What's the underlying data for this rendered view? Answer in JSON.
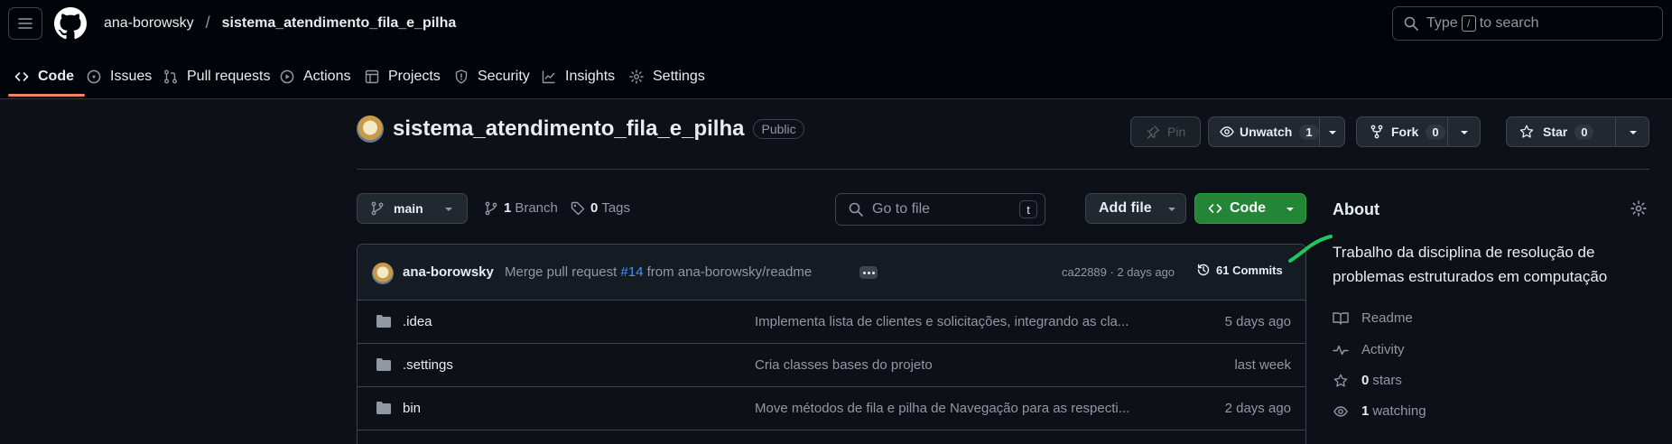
{
  "header": {
    "owner": "ana-borowsky",
    "separator": "/",
    "repo": "sistema_atendimento_fila_e_pilha",
    "search_prefix": "Type",
    "search_key": "/",
    "search_suffix": "to search"
  },
  "tabs": [
    {
      "label": "Code",
      "icon": "code-icon"
    },
    {
      "label": "Issues",
      "icon": "issue-icon"
    },
    {
      "label": "Pull requests",
      "icon": "pull-request-icon"
    },
    {
      "label": "Actions",
      "icon": "play-icon"
    },
    {
      "label": "Projects",
      "icon": "table-icon"
    },
    {
      "label": "Security",
      "icon": "shield-icon"
    },
    {
      "label": "Insights",
      "icon": "graph-icon"
    },
    {
      "label": "Settings",
      "icon": "gear-icon"
    }
  ],
  "repo_header": {
    "name": "sistema_atendimento_fila_e_pilha",
    "visibility": "Public",
    "pin_label": "Pin",
    "unwatch_label": "Unwatch",
    "unwatch_count": "1",
    "fork_label": "Fork",
    "fork_count": "0",
    "star_label": "Star",
    "star_count": "0"
  },
  "controls": {
    "branch": "main",
    "branches_count": "1",
    "branches_label": "Branch",
    "tags_count": "0",
    "tags_label": "Tags",
    "goto_placeholder": "Go to file",
    "goto_key": "t",
    "add_file_label": "Add file",
    "code_label": "Code"
  },
  "latest_commit": {
    "author": "ana-borowsky",
    "message_prefix": "Merge pull request",
    "pr": "#14",
    "message_suffix": "from ana-borowsky/readme",
    "hash_and_time": "ca22889 · 2 days ago",
    "commits_label": "61 Commits"
  },
  "files": [
    {
      "name": ".idea",
      "message": "Implementa lista de clientes e solicitações, integrando as cla...",
      "date": "5 days ago"
    },
    {
      "name": ".settings",
      "message": "Cria classes bases do projeto",
      "date": "last week"
    },
    {
      "name": "bin",
      "message": "Move métodos de fila e pilha de Navegação para as respecti...",
      "date": "2 days ago"
    }
  ],
  "about": {
    "title": "About",
    "description": "Trabalho da disciplina de resolução de problemas estruturados em computação",
    "readme_label": "Readme",
    "activity_label": "Activity",
    "stars_count": "0",
    "stars_label": "stars",
    "watching_count": "1",
    "watching_label": "watching"
  },
  "colors": {
    "background": "#0d1117",
    "topbar": "#010409",
    "accent_underline": "#f78166",
    "code_button": "#238636",
    "link": "#4493f8",
    "annotation_stroke": "#22c55e"
  }
}
